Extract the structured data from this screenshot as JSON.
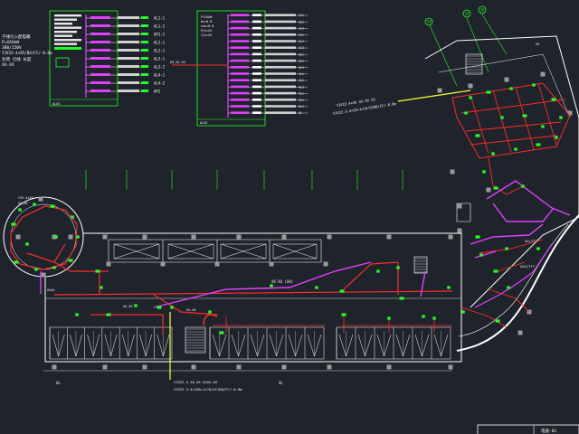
{
  "panel_a": {
    "title_lines": [
      "干线引入配电箱",
      "P=XXXkW",
      "380/220V",
      "YJV22-4×95/BX/FC/-0.8m",
      "负荷 引线 长度",
      "XX-XX"
    ],
    "feeders": [
      "AL1-1",
      "AL1-2",
      "AP1-1",
      "AL2-1",
      "AL2-2",
      "AL3-1",
      "AL3-2",
      "AL4-1",
      "AL4-2",
      "AP2"
    ],
    "footer": "AL01"
  },
  "panel_b": {
    "left_lines": [
      "P=XXkW",
      "Kx=0.8",
      "cos=0.8",
      "Pjs=XX",
      "Ijs=XX"
    ],
    "incomer": "DZ-XX-XX",
    "feeders": [
      "1L1",
      "1L2",
      "1L3",
      "2L1",
      "2L2",
      "2L3",
      "3L1",
      "3L2",
      "3L3",
      "4L1",
      "4L2",
      "4L3",
      "5L1",
      "5L2",
      "5L3",
      "AL"
    ],
    "footer": "AL02"
  },
  "grid_bubbles": [
    "14",
    "15",
    "16"
  ],
  "annotations": {
    "cable_right": "YJV22-3-4×25+1×16/SC80/FC/-0.8m",
    "cable_right_title": "YJV22-4×35 XX-XX XX",
    "cable_bottom_title": "YJV22-4 XX-XX XXXX-XX",
    "cable_bottom": "YJV22-3-4×150+1×70/SC100/FC/-0.8m",
    "circle_left_a": "YJV-4×XX",
    "circle_left_b": "XX-XX",
    "corridor_label": "XX-XX (XX)",
    "rp_label": "XX",
    "curve_label": "XX/???",
    "lobby_label": "XXX/???",
    "bottom_left": "AL",
    "bottom_mid": "XL",
    "room_label": "XX-XX",
    "stair_label": "XX-XX",
    "small_left": "XXXX"
  },
  "title_block": {
    "drawing_no": "电施-01"
  },
  "colors": {
    "background": "#1f232b",
    "wall": "#ffffff",
    "grid": "#aaaaaa",
    "power": "#ff2a2a",
    "lighting": "#e040ff",
    "equipment": "#22ff22",
    "text": "#ffffff",
    "highlight": "#ffff33"
  }
}
